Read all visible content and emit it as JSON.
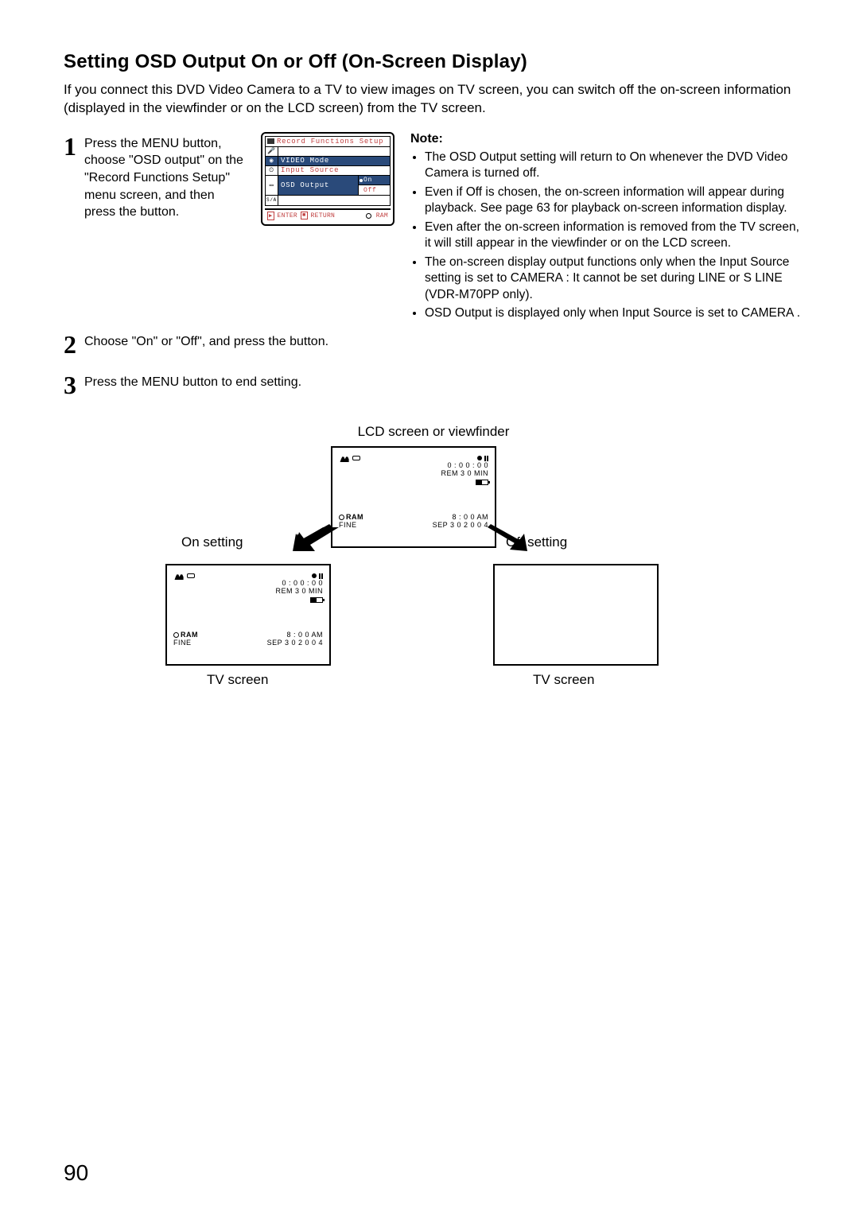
{
  "title": "Setting OSD Output On or Off (On-Screen Display)",
  "intro": "If you connect this DVD Video Camera to a TV to view images on TV screen, you can switch off the on-screen information (displayed in the viewfinder or on the LCD screen) from the TV screen.",
  "steps": {
    "s1": "Press the MENU button, choose \"OSD output\" on the \"Record Functions Setup\" menu screen, and then press the          button.",
    "s2": "Choose \"On\" or \"Off\", and press the          button.",
    "s3": "Press the MENU button to end setting."
  },
  "note_title": "Note:",
  "notes": [
    "The OSD Output setting will return to On whenever the DVD Video Camera is turned off.",
    "Even if Off is chosen, the on-screen information will appear during playback. See page 63 for playback on-screen information display.",
    "Even after the on-screen information is removed from the TV screen, it will still appear in the viewfinder or on the LCD screen.",
    "The on-screen display output functions only when the Input Source setting is set to CAMERA : It cannot be set during LINE or S LINE (VDR-M70PP only).",
    "OSD Output is displayed only when Input Source is set to CAMERA ."
  ],
  "menu": {
    "title": "Record Functions Setup",
    "items": [
      "",
      "VIDEO Mode",
      "Input Source",
      "OSD Output",
      ""
    ],
    "options": [
      "On",
      "Off"
    ],
    "footer_enter": "ENTER",
    "footer_return": "RETURN",
    "footer_ram": "RAM"
  },
  "diagram": {
    "caption": "LCD screen or viewfinder",
    "on_label": "On setting",
    "off_label": "Off setting",
    "tv_label": "TV screen"
  },
  "osd": {
    "time": "0 : 0 0 : 0 0",
    "rem": "REM 3 0 MIN",
    "ram": "RAM",
    "fine": "FINE",
    "clock": "8 : 0 0 AM",
    "date": "SEP 3 0 2 0 0 4"
  },
  "page_number": "90"
}
